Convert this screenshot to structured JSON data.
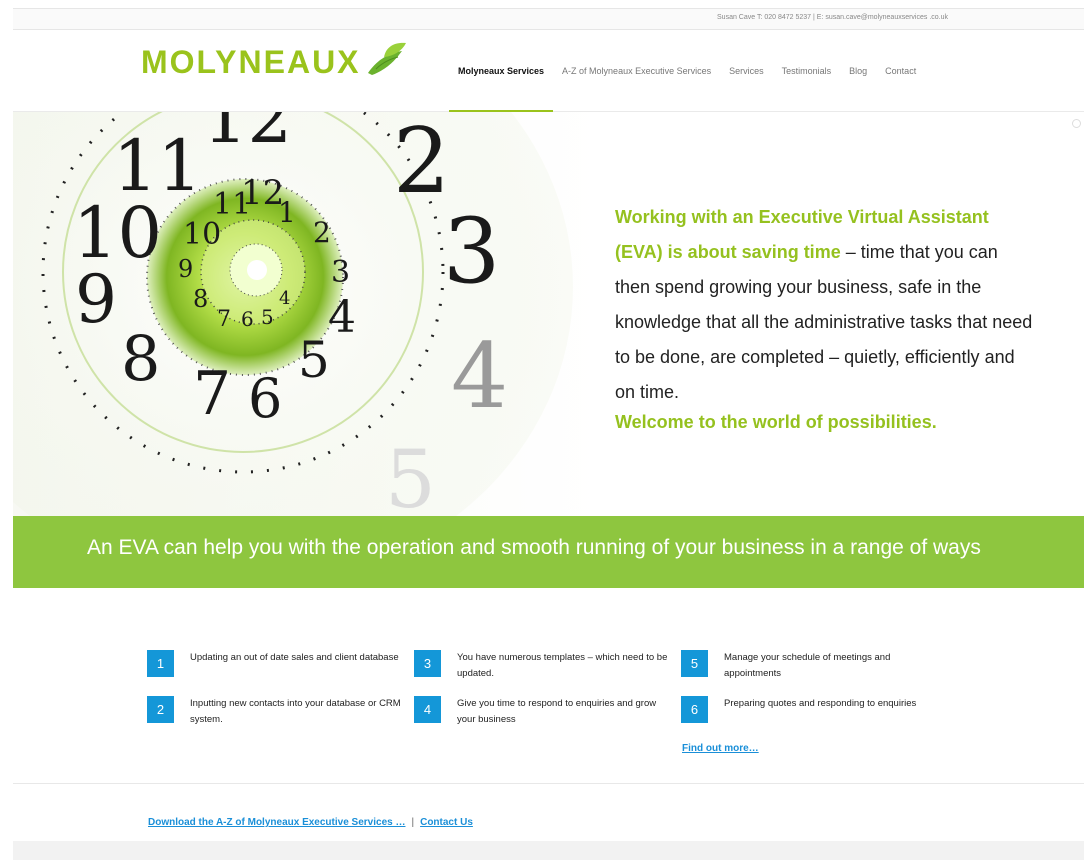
{
  "topbar": {
    "contact": "Susan Cave T: 020 8472 5237 | E: susan.cave@molyneauxservices .co.uk"
  },
  "logo": {
    "text": "MOLYNEAUX",
    "icon": "leaf-bird-icon"
  },
  "nav": {
    "items": [
      {
        "label": "Molyneaux Services",
        "active": true
      },
      {
        "label": "A-Z of Molyneaux Executive Services"
      },
      {
        "label": "Services"
      },
      {
        "label": "Testimonials"
      },
      {
        "label": "Blog"
      },
      {
        "label": "Contact"
      }
    ]
  },
  "hero": {
    "highlight": "Working with an Executive Virtual Assistant (EVA) is about saving time",
    "body": " – time that you can then spend growing your business, safe in the knowledge that all the administrative tasks that need to be done, are completed – quietly, efficiently and on time.",
    "tagline": "Welcome to the world of possibilities.",
    "image": "spiral-clock-image"
  },
  "banner": {
    "text": "An EVA can help you with the operation and smooth running of your business in a range of ways"
  },
  "services": [
    {
      "num": "1",
      "text": "Updating an out of date sales and client database"
    },
    {
      "num": "2",
      "text": "Inputting new contacts into your database or CRM system."
    },
    {
      "num": "3",
      "text": "You have numerous templates – which need to be updated."
    },
    {
      "num": "4",
      "text": "Give you time to respond to enquiries and grow your business"
    },
    {
      "num": "5",
      "text": "Manage your schedule of meetings and appointments"
    },
    {
      "num": "6",
      "text": "Preparing quotes and responding to enquiries"
    }
  ],
  "find_more": "Find out more…",
  "footer": {
    "download": "Download the A-Z of Molyneaux Executive Services …",
    "separator": "|",
    "contact": "Contact Us"
  },
  "colors": {
    "brand_green": "#95c11f",
    "banner_green": "#8ec63f",
    "link_blue": "#1a8fd8",
    "badge_blue": "#1497d8"
  }
}
